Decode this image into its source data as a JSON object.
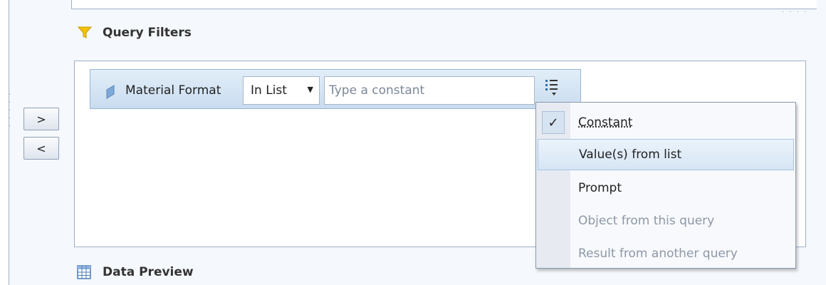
{
  "query_filters": {
    "title": "Query Filters",
    "title_icon": "funnel-icon",
    "filter": {
      "object_name": "Material Format",
      "object_icon": "dimension-object-icon",
      "operator": "In List",
      "value_placeholder": "Type a constant",
      "value_source_icon": "list-dropdown-icon"
    }
  },
  "nav": {
    "next_label": ">",
    "prev_label": "<"
  },
  "value_menu": {
    "items": [
      {
        "label": "Constant",
        "checked": true,
        "enabled": true
      },
      {
        "label": "Value(s) from list",
        "checked": false,
        "enabled": true,
        "hovered": true
      },
      {
        "label": "Prompt",
        "checked": false,
        "enabled": true
      },
      {
        "label": "Object from this query",
        "checked": false,
        "enabled": false
      },
      {
        "label": "Result from another query",
        "checked": false,
        "enabled": false
      }
    ]
  },
  "data_preview": {
    "title": "Data Preview",
    "title_icon": "table-grid-icon"
  },
  "colors": {
    "filter_row_bg": "#c9dcef",
    "menu_hover": "#d6e5f5",
    "disabled_text": "#8e98a6"
  }
}
